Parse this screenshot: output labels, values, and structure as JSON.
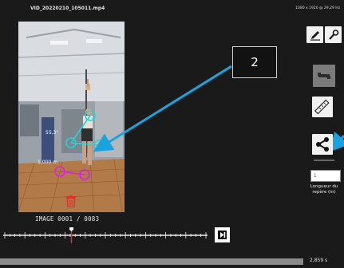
{
  "header": {
    "filename": "VID_20220210_105011.mp4",
    "resolution": "1080 x 1920 @ 29,29 Hz"
  },
  "video": {
    "angle_label": "55,3°",
    "scale_label": "1,000 m"
  },
  "callout": {
    "label": "2"
  },
  "toolbar": {
    "length_value": "1",
    "length_label": "Longueur du repère (m)"
  },
  "frame": {
    "counter": "IMAGE 0001 / 0083"
  },
  "playback": {
    "time": "2,859 s",
    "progress": 0.0
  },
  "colors": {
    "accent": "#1ba3e0",
    "joint": "#22d3d8",
    "marker": "#e020e0",
    "delete": "#e03030"
  },
  "icons": [
    "pencil-icon",
    "wrench-icon",
    "segment-icon",
    "ruler-icon",
    "share-icon",
    "trash-icon",
    "next-frame-icon"
  ]
}
